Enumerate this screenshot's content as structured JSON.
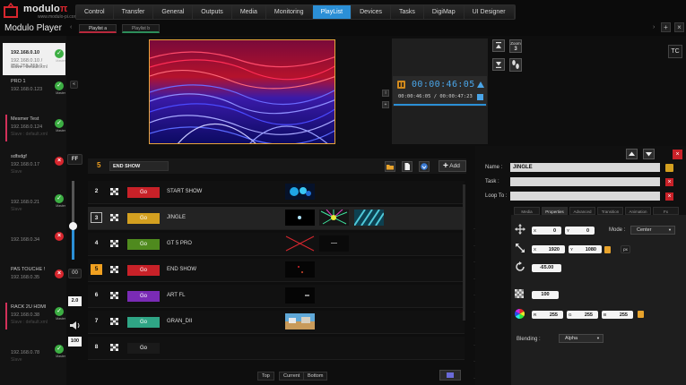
{
  "brand": {
    "name": "modulo",
    "glyph": "π",
    "sub": "www.modulo-pi.com",
    "app_name": "Modulo Player"
  },
  "menu": [
    {
      "label": "Control",
      "active": false
    },
    {
      "label": "Transfer",
      "active": false
    },
    {
      "label": "General",
      "active": false
    },
    {
      "label": "Outputs",
      "active": false
    },
    {
      "label": "Media",
      "active": false
    },
    {
      "label": "Monitoring",
      "active": false
    },
    {
      "label": "PlayList",
      "active": true
    },
    {
      "label": "Devices",
      "active": false
    },
    {
      "label": "Tasks",
      "active": false
    },
    {
      "label": "DigiMap",
      "active": false
    },
    {
      "label": "UI Designer",
      "active": false
    }
  ],
  "playlist_tabs": [
    "Playlist a",
    "Playlist b"
  ],
  "toolbar": {
    "add_symbol": "+",
    "close_symbol": "×",
    "tc_label": "TC"
  },
  "devices": [
    {
      "name": "192.168.0.10",
      "ip": "192.168.0.10 / 255.255.255.0",
      "sub": "Slave : default.xml",
      "status": "ok",
      "role": "Master"
    },
    {
      "name": "PRO 1",
      "ip": "192.168.0.123",
      "sub": "",
      "status": "ok",
      "role": "Master"
    },
    {
      "name": "Mesmer Test",
      "ip": "192.168.0.124",
      "sub": "Slave : default.xml",
      "status": "ok",
      "role": "Master"
    },
    {
      "name": "sdfsdgf",
      "ip": "192.168.0.17",
      "sub": "Slave",
      "status": "bad",
      "role": ""
    },
    {
      "name": "",
      "ip": "192.168.0.21",
      "sub": "Slave",
      "status": "ok",
      "role": "Master"
    },
    {
      "name": "",
      "ip": "192.168.0.34",
      "sub": "",
      "status": "bad",
      "role": ""
    },
    {
      "name": "PAS TOUCHE !",
      "ip": "192.168.0.35",
      "sub": "",
      "status": "bad",
      "role": ""
    },
    {
      "name": "RACK 2U HDMI",
      "ip": "192.168.0.38",
      "sub": "Slave : default.xml",
      "status": "ok",
      "role": "Master"
    },
    {
      "name": "",
      "ip": "192.168.0.78",
      "sub": "Slave",
      "status": "ok",
      "role": "Master"
    }
  ],
  "controls": {
    "ff": "FF",
    "fade": "00",
    "speed": "2.0",
    "volume": "100",
    "fade_level": 0.42,
    "volume_icon": "speaker-icon"
  },
  "transport": {
    "timecode": "00:00:46:05",
    "timecode_sub": "00:00:46:05 / 00:00:47:23",
    "zoom_label": "Zoom",
    "zoom_value": "3"
  },
  "cue_list": {
    "current_num": "5",
    "current_name": "END SHOW",
    "add_label": "Add",
    "footer": [
      "Top",
      "Current",
      "Bottom"
    ],
    "rows": [
      {
        "num": "2",
        "go_label": "Go",
        "go_color": "#c82128",
        "name": "START SHOW",
        "state": ""
      },
      {
        "num": "3",
        "go_label": "Go",
        "go_color": "#d4a020",
        "name": "JINGLE",
        "state": "selected"
      },
      {
        "num": "4",
        "go_label": "Go",
        "go_color": "#4f8a1e",
        "name": "GT 5 PRO",
        "state": ""
      },
      {
        "num": "5",
        "go_label": "Go",
        "go_color": "#c82128",
        "name": "END SHOW",
        "state": "live"
      },
      {
        "num": "6",
        "go_label": "Go",
        "go_color": "#7a2bb5",
        "name": "ART FL",
        "state": ""
      },
      {
        "num": "7",
        "go_label": "Go",
        "go_color": "#2fa585",
        "name": "GRAN_DII",
        "state": ""
      },
      {
        "num": "8",
        "go_label": "Go",
        "go_color": "#1a1a1a",
        "name": "",
        "state": ""
      }
    ]
  },
  "layers": [
    "1",
    "2",
    "3",
    "4",
    "5",
    "6",
    "7",
    "8",
    "9",
    "10"
  ],
  "properties": {
    "name_label": "Name :",
    "name_value": "JINGLE",
    "task_label": "Task :",
    "loop_label": "Loop To :",
    "tabs": [
      {
        "label": "Media",
        "active": false
      },
      {
        "label": "Properties",
        "active": true
      },
      {
        "label": "Advanced",
        "active": false
      },
      {
        "label": "Transition",
        "active": false
      },
      {
        "label": "Animation",
        "active": false
      },
      {
        "label": "Fx",
        "active": false
      }
    ],
    "pos_x": "0",
    "pos_y": "0",
    "mode_label": "Mode :",
    "mode_value": "Center",
    "size_x": "1920",
    "size_y": "1080",
    "size_badge": "px",
    "rotation": "-65.00",
    "opacity": "100",
    "color_r": "255",
    "color_g": "255",
    "color_b": "255",
    "blending_label": "Blending :",
    "blending_value": "Alpha"
  }
}
